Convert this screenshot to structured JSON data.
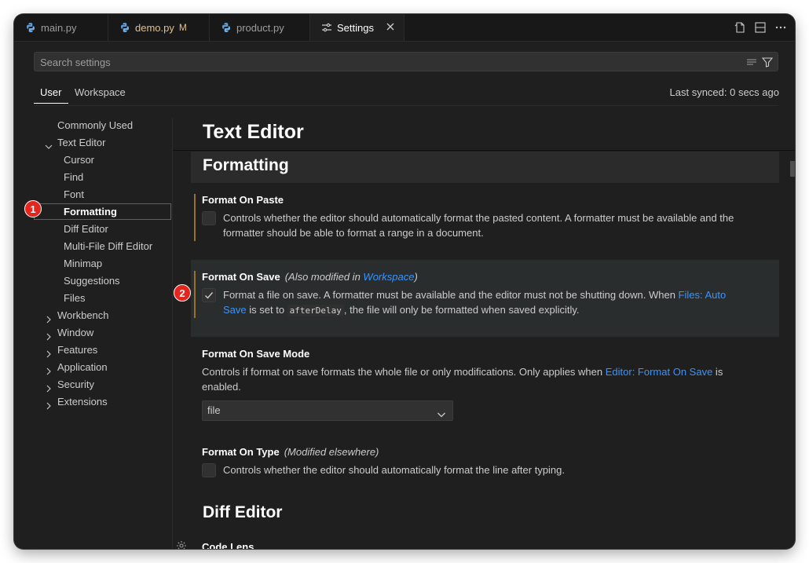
{
  "tabs": [
    {
      "label": "main.py",
      "icon": "python-icon"
    },
    {
      "label": "demo.py",
      "icon": "python-icon",
      "badge": "M"
    },
    {
      "label": "product.py",
      "icon": "python-icon"
    },
    {
      "label": "Settings",
      "icon": "settings-sliders-icon",
      "active": true
    }
  ],
  "tab_actions": [
    "open-settings-json-icon",
    "split-editor-icon",
    "more-actions-icon"
  ],
  "search": {
    "placeholder": "Search settings"
  },
  "scope": {
    "user": "User",
    "workspace": "Workspace",
    "last_synced": "Last synced: 0 secs ago"
  },
  "tree": {
    "commonly_used": "Commonly Used",
    "text_editor": "Text Editor",
    "children": [
      "Cursor",
      "Find",
      "Font",
      "Formatting",
      "Diff Editor",
      "Multi-File Diff Editor",
      "Minimap",
      "Suggestions",
      "Files"
    ],
    "groups": [
      "Workbench",
      "Window",
      "Features",
      "Application",
      "Security",
      "Extensions"
    ]
  },
  "badges": [
    "1",
    "2"
  ],
  "content": {
    "header": "Text Editor",
    "section": "Formatting",
    "format_on_paste": {
      "title": "Format On Paste",
      "desc_line1": "Controls whether the editor should automatically format the pasted content. A formatter must be available and the",
      "desc_line2": "formatter should be able to format a range in a document.",
      "checked": false
    },
    "format_on_save": {
      "title": "Format On Save",
      "note_prefix": "(Also modified in ",
      "note_link": "Workspace",
      "note_suffix": ")",
      "desc_line1": "Format a file on save. A formatter must be available and the editor must not be shutting down. When ",
      "desc_link1": "Files: Auto",
      "desc_link2": "Save",
      "desc_mid": " is set to ",
      "desc_code": "afterDelay",
      "desc_end": ", the file will only be formatted when saved explicitly.",
      "checked": true
    },
    "format_on_save_mode": {
      "title": "Format On Save Mode",
      "desc_line1": "Controls if format on save formats the whole file or only modifications. Only applies when ",
      "desc_link": "Editor: Format On Save",
      "desc_after": " is",
      "desc_line2": "enabled.",
      "value": "file"
    },
    "format_on_type": {
      "title": "Format On Type",
      "note": "(Modified elsewhere)",
      "desc": "Controls whether the editor should automatically format the line after typing.",
      "checked": false
    },
    "next_section": "Diff Editor",
    "next_setting": "Code Lens"
  },
  "colors": {
    "accent": "#0078d4",
    "link": "#3794ff",
    "modified": "#e2c08d",
    "badge": "#e5261f"
  }
}
